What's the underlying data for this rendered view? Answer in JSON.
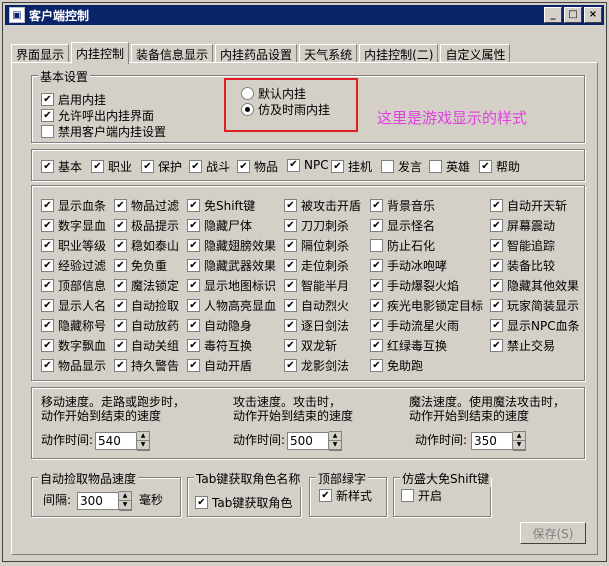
{
  "window": {
    "title": "客户端控制",
    "min": "_",
    "max": "□",
    "close": "×"
  },
  "tabs": [
    "界面显示",
    "内挂控制",
    "装备信息显示",
    "内挂药品设置",
    "天气系统",
    "内挂控制(二)",
    "自定义属性"
  ],
  "basic": {
    "legend": "基本设置",
    "items": [
      {
        "label": "启用内挂",
        "checked": true
      },
      {
        "label": "允许呼出内挂界面",
        "checked": true
      },
      {
        "label": "禁用客户端内挂设置",
        "checked": false
      }
    ],
    "radios": [
      {
        "label": "默认内挂",
        "selected": false
      },
      {
        "label": "仿及时雨内挂",
        "selected": true
      }
    ]
  },
  "annotation": "这里是游戏显示的样式",
  "row_items": [
    {
      "label": "基本",
      "checked": true
    },
    {
      "label": "职业",
      "checked": true
    },
    {
      "label": "保护",
      "checked": true
    },
    {
      "label": "战斗",
      "checked": true
    },
    {
      "label": "物品",
      "checked": true
    },
    {
      "label": "NPC",
      "checked": true
    },
    {
      "label": "挂机",
      "checked": true
    },
    {
      "label": "发言",
      "checked": false
    },
    {
      "label": "英雄",
      "checked": false
    },
    {
      "label": "帮助",
      "checked": true
    }
  ],
  "grid_cols": [
    [
      {
        "label": "显示血条",
        "checked": true
      },
      {
        "label": "数字显血",
        "checked": true
      },
      {
        "label": "职业等级",
        "checked": true
      },
      {
        "label": "经验过滤",
        "checked": true
      },
      {
        "label": "顶部信息",
        "checked": true
      },
      {
        "label": "显示人名",
        "checked": true
      },
      {
        "label": "隐藏称号",
        "checked": true
      },
      {
        "label": "数字飘血",
        "checked": true
      },
      {
        "label": "物品显示",
        "checked": true
      }
    ],
    [
      {
        "label": "物品过滤",
        "checked": true
      },
      {
        "label": "极品提示",
        "checked": true
      },
      {
        "label": "稳如泰山",
        "checked": true
      },
      {
        "label": "免负重",
        "checked": true
      },
      {
        "label": "魔法锁定",
        "checked": true
      },
      {
        "label": "自动捡取",
        "checked": true
      },
      {
        "label": "自动放药",
        "checked": true
      },
      {
        "label": "自动关组",
        "checked": true
      },
      {
        "label": "持久警告",
        "checked": true
      }
    ],
    [
      {
        "label": "免Shift键",
        "checked": true
      },
      {
        "label": "隐藏尸体",
        "checked": true
      },
      {
        "label": "隐藏翅膀效果",
        "checked": true
      },
      {
        "label": "隐藏武器效果",
        "checked": true
      },
      {
        "label": "显示地图标识",
        "checked": true
      },
      {
        "label": "人物高亮显血",
        "checked": true
      },
      {
        "label": "自动隐身",
        "checked": true
      },
      {
        "label": "毒符互换",
        "checked": true
      },
      {
        "label": "自动开盾",
        "checked": true
      }
    ],
    [
      {
        "label": "被攻击开盾",
        "checked": true
      },
      {
        "label": "刀刀刺杀",
        "checked": true
      },
      {
        "label": "隔位刺杀",
        "checked": true
      },
      {
        "label": "走位刺杀",
        "checked": true
      },
      {
        "label": "智能半月",
        "checked": true
      },
      {
        "label": "自动烈火",
        "checked": true
      },
      {
        "label": "逐日剑法",
        "checked": true
      },
      {
        "label": "双龙斩",
        "checked": true
      },
      {
        "label": "龙影剑法",
        "checked": true
      }
    ],
    [
      {
        "label": "背景音乐",
        "checked": true
      },
      {
        "label": "显示怪名",
        "checked": true
      },
      {
        "label": "防止石化",
        "checked": false
      },
      {
        "label": "手动冰咆哮",
        "checked": true
      },
      {
        "label": "手动爆裂火焰",
        "checked": true
      },
      {
        "label": "疾光电影锁定目标",
        "checked": true
      },
      {
        "label": "手动流星火雨",
        "checked": true
      },
      {
        "label": "红绿毒互换",
        "checked": true
      },
      {
        "label": "免助跑",
        "checked": true
      }
    ],
    [
      {
        "label": "自动开天斩",
        "checked": true
      },
      {
        "label": "屏幕震动",
        "checked": true
      },
      {
        "label": "智能追踪",
        "checked": true
      },
      {
        "label": "装备比较",
        "checked": true
      },
      {
        "label": "隐藏其他效果",
        "checked": true
      },
      {
        "label": "玩家简装显示",
        "checked": true
      },
      {
        "label": "显示NPC血条",
        "checked": true
      },
      {
        "label": "禁止交易",
        "checked": true
      }
    ]
  ],
  "speed": {
    "move": {
      "desc1": "移动速度。走路或跑步时，",
      "desc2": "动作开始到结束的速度",
      "label": "动作时间:",
      "value": "540"
    },
    "attack": {
      "desc1": "攻击速度。攻击时，",
      "desc2": "动作开始到结束的速度",
      "label": "动作时间:",
      "value": "500"
    },
    "magic": {
      "desc1": "魔法速度。使用魔法攻击时，",
      "desc2": "动作开始到结束的速度",
      "label": "动作时间:",
      "value": "350"
    }
  },
  "pickup": {
    "legend": "自动捡取物品速度",
    "label": "间隔:",
    "value": "300",
    "unit": "毫秒"
  },
  "tabname": {
    "legend": "Tab键获取角色名称",
    "label": "Tab键获取角色",
    "checked": true
  },
  "topgreen": {
    "legend": "顶部绿字",
    "label": "新样式",
    "checked": true
  },
  "shift": {
    "legend": "仿盛大免Shift键",
    "label": "开启",
    "checked": false
  },
  "save_label": "保存(S)"
}
